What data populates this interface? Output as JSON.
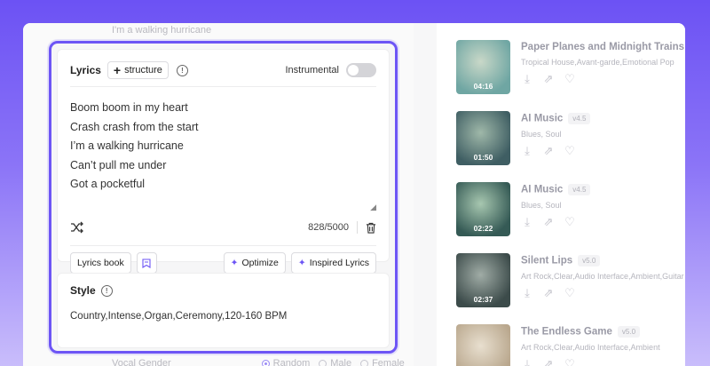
{
  "background_text": {
    "top_line": "I'm a walking hurricane",
    "vocal_gender_label": "Vocal Gender",
    "gender_options": [
      "Random",
      "Male",
      "Female"
    ]
  },
  "lyrics": {
    "title": "Lyrics",
    "structure_label": "structure",
    "instrumental_label": "Instrumental",
    "lines": [
      "Boom boom in my heart",
      "Crash crash from the start",
      "I’m a walking hurricane",
      "Can’t pull me under",
      "Got a pocketful"
    ],
    "char_count": "828/5000",
    "lyrics_book_label": "Lyrics book",
    "optimize_label": "Optimize",
    "inspired_label": "Inspired Lyrics"
  },
  "style": {
    "title": "Style",
    "value": "Country,Intense,Organ,Ceremony,120-160 BPM"
  },
  "songs": [
    {
      "title": "Paper Planes and Midnight Trains",
      "version": "",
      "tags": "Tropical House,Avant-garde,Emotional Pop",
      "duration": "04:16",
      "thumb_colors": [
        "#6fa6a3",
        "#c9d8c8"
      ]
    },
    {
      "title": "AI Music",
      "version": "v4.5",
      "tags": "Blues, Soul",
      "duration": "01:50",
      "thumb_colors": [
        "#3f5e63",
        "#9fb8a9"
      ]
    },
    {
      "title": "AI Music",
      "version": "v4.5",
      "tags": "Blues, Soul",
      "duration": "02:22",
      "thumb_colors": [
        "#355a55",
        "#a7c7b0"
      ]
    },
    {
      "title": "Silent Lips",
      "version": "v5.0",
      "tags": "Art Rock,Clear,Audio Interface,Ambient,Guitar",
      "duration": "02:37",
      "thumb_colors": [
        "#3c4b4a",
        "#a0aca6"
      ]
    },
    {
      "title": "The Endless Game",
      "version": "v5.0",
      "tags": "Art Rock,Clear,Audio Interface,Ambient",
      "duration": "",
      "thumb_colors": [
        "#b9a78d",
        "#e8dfcf"
      ]
    }
  ],
  "colors": {
    "accent": "#6d55f5",
    "page_gradient_top": "#6c52f4"
  }
}
